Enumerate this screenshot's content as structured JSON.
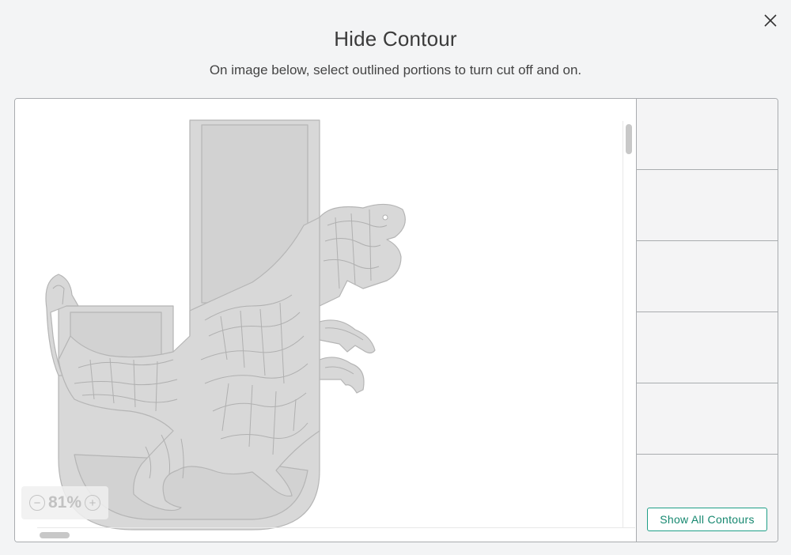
{
  "dialog": {
    "title": "Hide Contour",
    "subtitle": "On image below, select outlined portions to turn cut off and on.",
    "close_icon": "close-icon"
  },
  "canvas": {
    "zoom_level": "81%",
    "zoom_out_symbol": "−",
    "zoom_in_symbol": "+",
    "artwork": "Letter J with T-rex mandala design"
  },
  "sidebar": {
    "slot_count": 6,
    "show_all_label": "Show All Contours"
  },
  "colors": {
    "background": "#f3f4f5",
    "art_fill": "#d8d8d8",
    "art_stroke": "#b5b5b5",
    "accent": "#1f9e87"
  }
}
